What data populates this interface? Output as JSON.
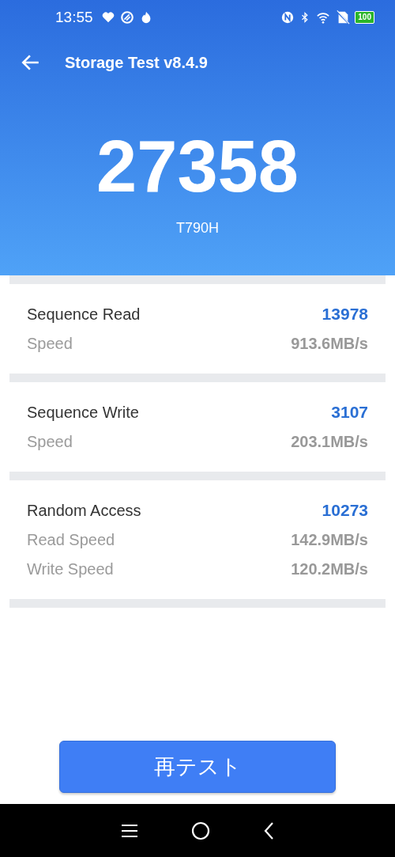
{
  "status_bar": {
    "time": "13:55",
    "battery": "100"
  },
  "header": {
    "title": "Storage Test v8.4.9",
    "score": "27358",
    "device": "T790H"
  },
  "sections": [
    {
      "title": "Sequence Read",
      "score": "13978",
      "rows": [
        {
          "label": "Speed",
          "value": "913.6MB/s"
        }
      ]
    },
    {
      "title": "Sequence Write",
      "score": "3107",
      "rows": [
        {
          "label": "Speed",
          "value": "203.1MB/s"
        }
      ]
    },
    {
      "title": "Random Access",
      "score": "10273",
      "rows": [
        {
          "label": "Read Speed",
          "value": "142.9MB/s"
        },
        {
          "label": "Write Speed",
          "value": "120.2MB/s"
        }
      ]
    }
  ],
  "retest_button": "再テスト"
}
